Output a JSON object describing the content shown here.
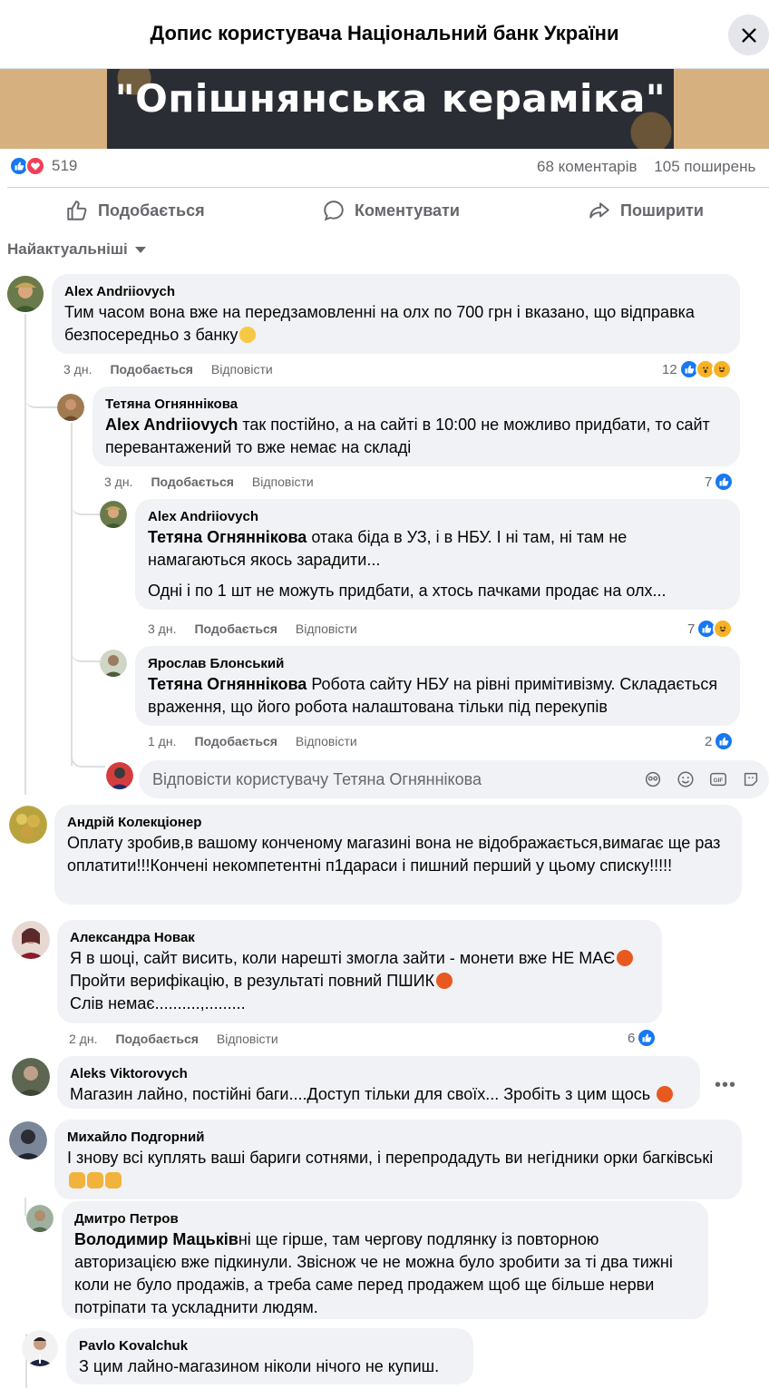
{
  "header": {
    "title": "Допис користувача Національний банк України"
  },
  "banner": {
    "text": "\"Опішнянська кераміка\""
  },
  "stats": {
    "reactions": "519",
    "comments": "68 коментарів",
    "shares": "105 поширень"
  },
  "actions": {
    "like": "Подобається",
    "comment": "Коментувати",
    "share": "Поширити"
  },
  "sort": {
    "label": "Найактуальніші"
  },
  "comments": [
    {
      "name": "Alex Andriiovych",
      "text": "Тим часом вона вже на передзамовленні на олх по 700 грн і вказано, що відправка безпосередньо з банку",
      "time": "3 дн.",
      "like": "Подобається",
      "reply": "Відповісти",
      "reactions": "12"
    },
    {
      "name": "Тетяна Огняннікова",
      "mention": "Alex Andriiovych",
      "text": " так постійно, а на сайті в 10:00 не можливо придбати, то сайт перевантажений то вже немає на складі",
      "time": "3 дн.",
      "like": "Подобається",
      "reply": "Відповісти",
      "reactions": "7"
    },
    {
      "name": "Alex Andriiovych",
      "mention": "Тетяна Огняннікова",
      "text": " отака біда в УЗ, і в НБУ. І ні там, ні там не намагаються якось зарадити...",
      "text2": "Одні і по 1 шт не можуть придбати, а хтось пачками продає на олх...",
      "time": "3 дн.",
      "like": "Подобається",
      "reply": "Відповісти",
      "reactions": "7"
    },
    {
      "name": "Ярослав Блонський",
      "mention": "Тетяна Огняннікова",
      "text": " Робота сайту НБУ на рівні примітивізму. Складається враження, що його робота налаштована тільки під перекупів",
      "time": "1 дн.",
      "like": "Подобається",
      "reply": "Відповісти",
      "reactions": "2"
    },
    {
      "name": "Андрій Колекціонер",
      "text": "Оплату зробив,в вашому конченому магазині вона не відображається,вимагає ще раз оплатити!!!Кончені некомпетентні п1дараси і пишний перший у цьому списку!!!!!"
    },
    {
      "name": "Александра Новак",
      "line1": "Я в шоці, сайт висить, коли нарешті змогла зайти - монети вже НЕ МАЄ",
      "line2": "Пройти верифікацію, в результаті повний ПШИК",
      "line3": "Слів немає..........,.........",
      "time": "2 дн.",
      "like": "Подобається",
      "reply": "Відповісти",
      "reactions": "6"
    },
    {
      "name": "Aleks Viktorovych",
      "text": "Магазин лайно, постійні баги....Доступ тільки для своїх... Зробіть з цим щось "
    },
    {
      "name": "Михайло Подгорний",
      "text": "І знову всі куплять ваші бариги сотнями, і перепродадуть ви негідники орки багківські"
    },
    {
      "name": "Дмитро Петров",
      "mention": "Володимир Мацьків",
      "text": "ні ще гірше, там чергову подлянку із повторною авторизацією вже підкинули. Звіснож че не можна було зробити за ті два тижні коли не було продажів, а треба саме перед продажем щоб ще більше нерви потріпати та ускладнити людям."
    },
    {
      "name": "Pavlo Kovalchuk",
      "text": "З цим лайно-магазином ніколи нічого не купиш."
    }
  ],
  "reply_box": {
    "placeholder": "Відповісти користувачу Тетяна Огняннікова"
  },
  "colors": {
    "accent": "#1877f2",
    "love": "#f33e58",
    "bubble": "#f0f2f5",
    "muted": "#65676b"
  }
}
